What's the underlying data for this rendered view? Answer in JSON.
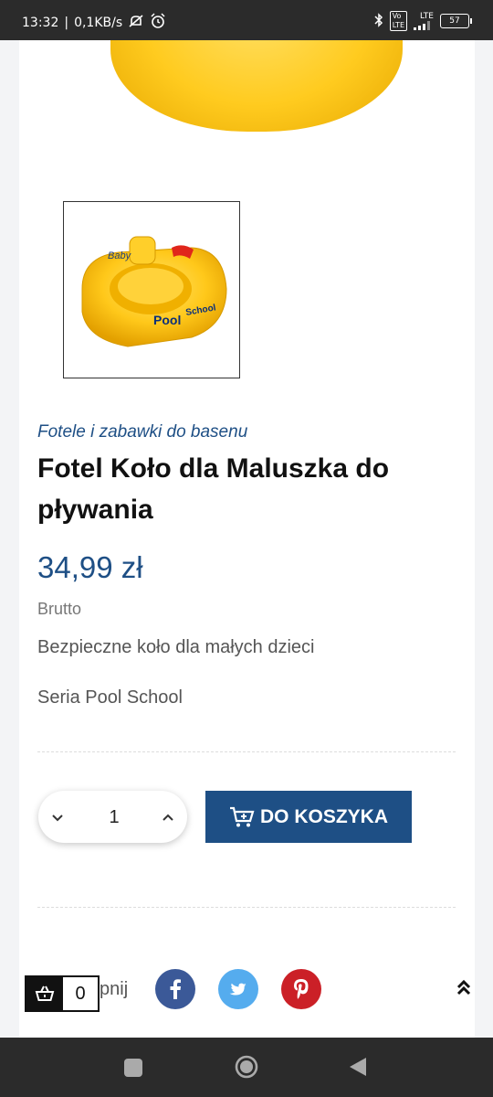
{
  "status_bar": {
    "time": "13:32",
    "separator": "|",
    "network_speed": "0,1KB/s",
    "icons": [
      "silent-icon",
      "alarm-icon",
      "bluetooth-icon",
      "volte-icon",
      "signal-icon"
    ],
    "network_type": "LTE",
    "battery": "57"
  },
  "product": {
    "category": "Fotele i zabawki do basenu",
    "title": "Fotel Koło dla Maluszka do pływania",
    "price": "34,99 zł",
    "price_note": "Brutto",
    "description_line1": "Bezpieczne koło dla małych dzieci",
    "description_line2": "Seria Pool School",
    "image_text": {
      "baby": "Baby",
      "pool": "Pool",
      "school": "School"
    }
  },
  "quantity": {
    "value": "1"
  },
  "add_to_cart": {
    "label": "DO KOSZYKA"
  },
  "share": {
    "label_visible": "pnij",
    "networks": [
      "facebook",
      "twitter",
      "pinterest"
    ]
  },
  "cart_widget": {
    "count": "0"
  },
  "colors": {
    "accent": "#1e4f85",
    "facebook": "#3b5998",
    "twitter": "#55acee",
    "pinterest": "#cb2027",
    "product_yellow": "#ffcb1f"
  }
}
